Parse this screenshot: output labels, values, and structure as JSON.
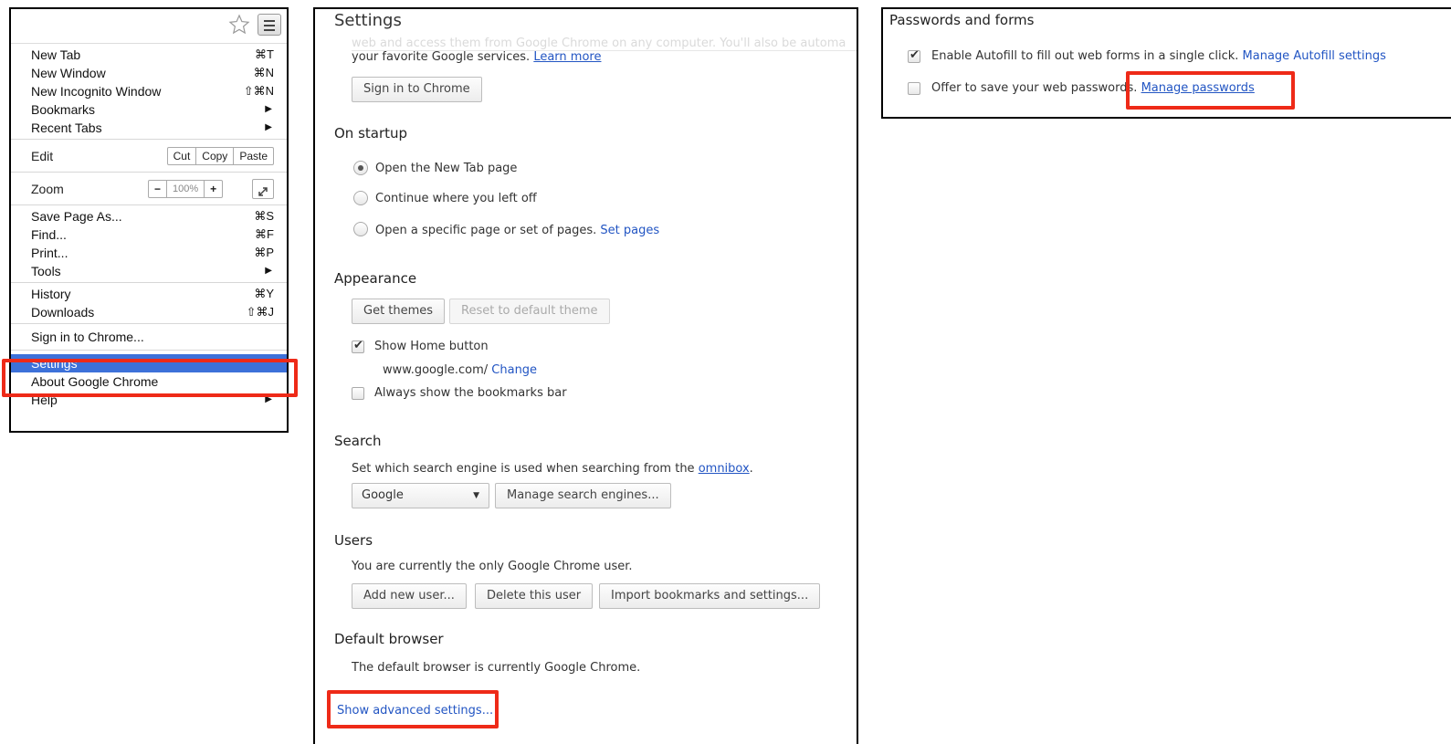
{
  "menu": {
    "items_group1": [
      {
        "label": "New Tab",
        "shortcut": "⌘T"
      },
      {
        "label": "New Window",
        "shortcut": "⌘N"
      },
      {
        "label": "New Incognito Window",
        "shortcut": "⇧⌘N"
      },
      {
        "label": "Bookmarks",
        "shortcut": "▶"
      },
      {
        "label": "Recent Tabs",
        "shortcut": "▶"
      }
    ],
    "edit": {
      "label": "Edit",
      "cut": "Cut",
      "copy": "Copy",
      "paste": "Paste"
    },
    "zoom": {
      "label": "Zoom",
      "minus": "−",
      "value": "100%",
      "plus": "+"
    },
    "items_group2": [
      {
        "label": "Save Page As...",
        "shortcut": "⌘S"
      },
      {
        "label": "Find...",
        "shortcut": "⌘F"
      },
      {
        "label": "Print...",
        "shortcut": "⌘P"
      },
      {
        "label": "Tools",
        "shortcut": "▶"
      }
    ],
    "items_group3": [
      {
        "label": "History",
        "shortcut": "⌘Y"
      },
      {
        "label": "Downloads",
        "shortcut": "⇧⌘J"
      }
    ],
    "sign_in": "Sign in to Chrome...",
    "settings": "Settings",
    "about": "About Google Chrome",
    "help": {
      "label": "Help",
      "shortcut": "▶"
    }
  },
  "settings": {
    "title": "Settings",
    "faded_text": "web and access them from Google Chrome on any computer. You'll also be automa",
    "signin_text": "your favorite Google services.",
    "learn_more": "Learn more",
    "signin_button": "Sign in to Chrome",
    "startup": {
      "heading": "On startup",
      "options": [
        "Open the New Tab page",
        "Continue where you left off",
        "Open a specific page or set of pages."
      ],
      "set_pages": "Set pages"
    },
    "appearance": {
      "heading": "Appearance",
      "get_themes": "Get themes",
      "reset_theme": "Reset to default theme",
      "show_home": "Show Home button",
      "home_url": "www.google.com/",
      "change": "Change",
      "bookmarks_bar": "Always show the bookmarks bar"
    },
    "search": {
      "heading": "Search",
      "description": "Set which search engine is used when searching from the",
      "omnibox": "omnibox",
      "period": ".",
      "engine": "Google",
      "manage": "Manage search engines..."
    },
    "users": {
      "heading": "Users",
      "description": "You are currently the only Google Chrome user.",
      "add": "Add new user...",
      "delete": "Delete this user",
      "import": "Import bookmarks and settings..."
    },
    "default_browser": {
      "heading": "Default browser",
      "description": "The default browser is currently Google Chrome."
    },
    "show_advanced": "Show advanced settings..."
  },
  "passwords": {
    "heading": "Passwords and forms",
    "autofill_text": "Enable Autofill to fill out web forms in a single click.",
    "autofill_link": "Manage Autofill settings",
    "save_text": "Offer to save your web passwords.",
    "manage_link": "Manage passwords"
  },
  "colors": {
    "highlight": "#ee2a18",
    "selected": "#3d71d9",
    "link": "#2255c3"
  }
}
